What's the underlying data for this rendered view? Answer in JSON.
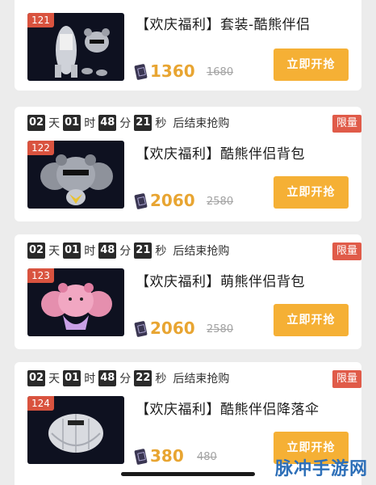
{
  "colors": {
    "page_bg": "#ececec",
    "card_bg": "#ffffff",
    "buy_button": "#f5b035",
    "price": "#e8a532",
    "limit_badge": "#e05b49",
    "index_badge": "#d9533f",
    "timer_box": "#2a2a2a"
  },
  "timer_units": {
    "day": "天",
    "hour": "时",
    "minute": "分",
    "second": "秒",
    "ending": "后结束抢购"
  },
  "items": [
    {
      "index": "121",
      "title": "【欢庆福利】套装-酷熊伴侣",
      "price": "1360",
      "original_price": "1680",
      "button": "立即开抢",
      "thumb_icon": "bear-suit-outfit-icon"
    },
    {
      "index": "122",
      "title": "【欢庆福利】酷熊伴侣背包",
      "price": "2060",
      "original_price": "2580",
      "button": "立即开抢",
      "limit_label": "限量",
      "countdown": {
        "days": "02",
        "hours": "01",
        "minutes": "48",
        "seconds": "21"
      },
      "thumb_icon": "grey-bear-backpack-icon"
    },
    {
      "index": "123",
      "title": "【欢庆福利】萌熊伴侣背包",
      "price": "2060",
      "original_price": "2580",
      "button": "立即开抢",
      "limit_label": "限量",
      "countdown": {
        "days": "02",
        "hours": "01",
        "minutes": "48",
        "seconds": "21"
      },
      "thumb_icon": "pink-bear-backpack-icon"
    },
    {
      "index": "124",
      "title": "【欢庆福利】酷熊伴侣降落伞",
      "price": "380",
      "original_price": "480",
      "button": "立即开抢",
      "limit_label": "限量",
      "countdown": {
        "days": "02",
        "hours": "01",
        "minutes": "48",
        "seconds": "22"
      },
      "thumb_icon": "parachute-icon"
    }
  ],
  "watermark": "脉冲手游网"
}
